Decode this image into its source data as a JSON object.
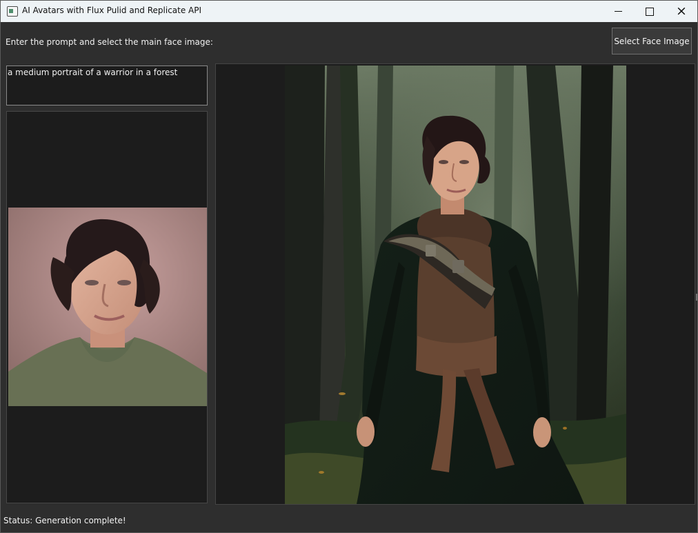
{
  "window": {
    "title": "AI Avatars with Flux Pulid and Replicate API",
    "controls": {
      "minimize": "minimize-icon",
      "maximize": "maximize-icon",
      "close": "close-icon"
    }
  },
  "prompt": {
    "label": "Enter the prompt and select the main face image:",
    "value": "a medium portrait of a warrior in a forest"
  },
  "buttons": {
    "select_face": "Select Face Image"
  },
  "status": {
    "text": "Status: Generation complete!"
  },
  "colors": {
    "titlebar": "#eef3f6",
    "window_background": "#2e2e2e",
    "panel_background": "#1c1c1c"
  }
}
